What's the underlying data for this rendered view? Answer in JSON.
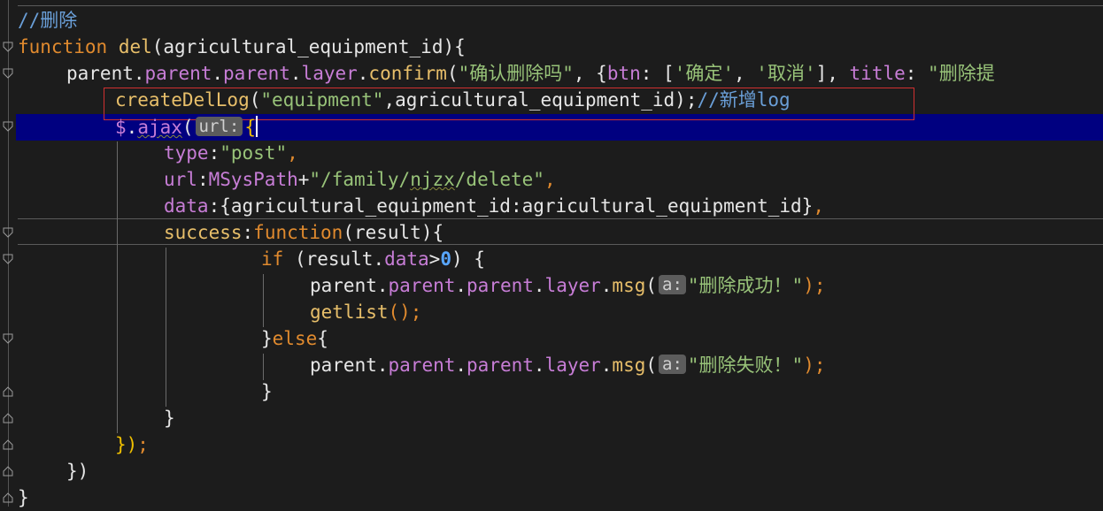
{
  "code": {
    "l1_comment": "//删除",
    "l2_kw": "function",
    "l2_name": "del",
    "l2_params": "(agricultural_equipment_id){",
    "l3_a": "parent",
    "l3_b": ".",
    "l3_c": "parent",
    "l3_d": "parent",
    "l3_e": "layer",
    "l3_f": "confirm",
    "l3_s1": "\"确认删除吗\"",
    "l3_g": ", {",
    "l3_btn": "btn",
    "l3_h": ": [",
    "l3_s2": "'确定'",
    "l3_comma": ", ",
    "l3_s3": "'取消'",
    "l3_i": "], ",
    "l3_title": "title",
    "l3_j": ": ",
    "l3_s4": "\"删除提",
    "l4_fn": "createDelLog",
    "l4_a": "(",
    "l4_s": "\"equipment\"",
    "l4_b": ",agricultural_equipment_id);",
    "l4_comment": "//新增log",
    "l5_dollar": "$",
    "l5_dot": ".",
    "l5_ajax": "ajax",
    "l5_paren": "(",
    "l5_hint": "url:",
    "l5_brace": "{",
    "l6_key": "type",
    "l6_colon": ":",
    "l6_val": "\"post\"",
    "l6_end": ",",
    "l7_key": "url",
    "l7_colon": ":",
    "l7_var": "MSysPath",
    "l7_plus": "+",
    "l7_s1": "\"/family/",
    "l7_s2": "njzx",
    "l7_s3": "/delete\"",
    "l7_end": ",",
    "l8_key": "data",
    "l8_rest": ":{agricultural_equipment_id:agricultural_equipment_id}",
    "l8_end": ",",
    "l9_key": "success",
    "l9_colon": ":",
    "l9_kw": "function",
    "l9_rest": "(result){",
    "l10_kw": "if",
    "l10_a": " (result.",
    "l10_prop": "data",
    "l10_gt": ">",
    "l10_num": "0",
    "l10_b": ") {",
    "l11_a": "parent",
    "l11_p1": "parent",
    "l11_p2": "parent",
    "l11_layer": "layer",
    "l11_msg": "msg",
    "l11_hint": "a:",
    "l11_s": "\"删除成功！\"",
    "l11_end": ");",
    "l12_fn": "getlist",
    "l12_end": "();",
    "l13_a": "}",
    "l13_kw": "else",
    "l13_b": "{",
    "l14_a": "parent",
    "l14_p1": "parent",
    "l14_p2": "parent",
    "l14_layer": "layer",
    "l14_msg": "msg",
    "l14_hint": "a:",
    "l14_s": "\"删除失败！\"",
    "l14_end": ");",
    "l15": "}",
    "l16": "}",
    "l17_brace": "})",
    "l17_end": ";",
    "l18": "})",
    "l19": "}"
  }
}
